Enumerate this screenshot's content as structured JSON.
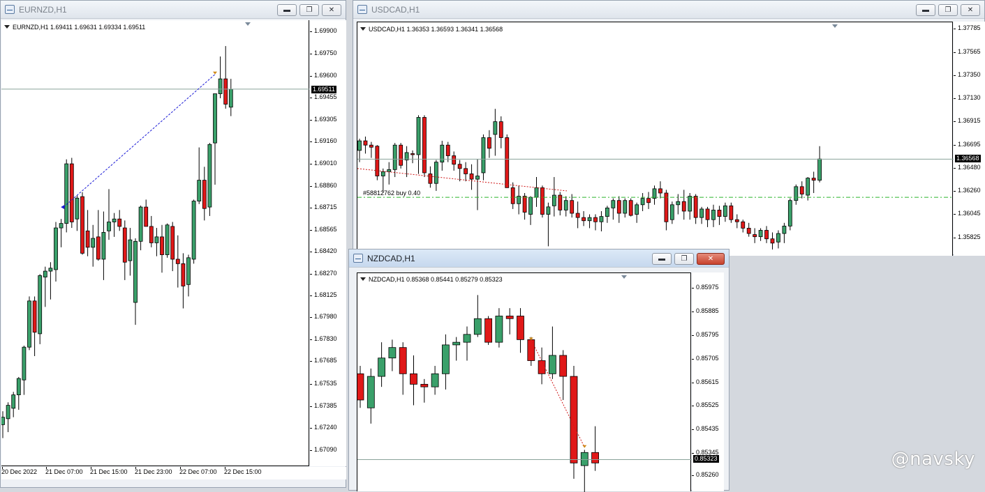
{
  "windows": {
    "eurnzd": {
      "title": "EURNZD,H1",
      "info": "EURNZD,H1  1.69411 1.69631 1.69334 1.69511",
      "current_price": "1.69511",
      "price_min": 1.67,
      "price_max": 1.6995,
      "price_labels": [
        "1.69900",
        "1.69750",
        "1.69600",
        "1.69455",
        "1.69305",
        "1.69160",
        "1.69010",
        "1.68860",
        "1.68715",
        "1.68565",
        "1.68420",
        "1.68270",
        "1.68125",
        "1.67980",
        "1.67830",
        "1.67685",
        "1.67535",
        "1.67385",
        "1.67240",
        "1.67090"
      ],
      "time_labels": [
        "20 Dec 2022",
        "21 Dec 07:00",
        "21 Dec 15:00",
        "21 Dec 23:00",
        "22 Dec 07:00",
        "22 Dec 15:00"
      ],
      "candles": [
        [
          1.6726,
          1.6735,
          1.6717,
          1.6731
        ],
        [
          1.673,
          1.6741,
          1.6721,
          1.6739
        ],
        [
          1.6737,
          1.6748,
          1.6731,
          1.6746
        ],
        [
          1.6746,
          1.6758,
          1.6736,
          1.6757
        ],
        [
          1.6756,
          1.6779,
          1.6746,
          1.6778
        ],
        [
          1.6778,
          1.6812,
          1.6776,
          1.6809
        ],
        [
          1.6809,
          1.6812,
          1.6772,
          1.6788
        ],
        [
          1.6787,
          1.6827,
          1.678,
          1.6826
        ],
        [
          1.6825,
          1.6832,
          1.6805,
          1.6829
        ],
        [
          1.6829,
          1.6835,
          1.681,
          1.6831
        ],
        [
          1.683,
          1.6862,
          1.6822,
          1.6858
        ],
        [
          1.6858,
          1.6864,
          1.6845,
          1.6861
        ],
        [
          1.6861,
          1.6904,
          1.6855,
          1.6901
        ],
        [
          1.6901,
          1.6905,
          1.6858,
          1.6862
        ],
        [
          1.6864,
          1.688,
          1.6856,
          1.6878
        ],
        [
          1.6879,
          1.6882,
          1.684,
          1.6841
        ],
        [
          1.6856,
          1.687,
          1.6839,
          1.6845
        ],
        [
          1.6845,
          1.686,
          1.6832,
          1.6851
        ],
        [
          1.6852,
          1.687,
          1.6836,
          1.6837
        ],
        [
          1.6837,
          1.6869,
          1.6823,
          1.6855
        ],
        [
          1.6856,
          1.6884,
          1.685,
          1.6862
        ],
        [
          1.6862,
          1.6868,
          1.6852,
          1.6864
        ],
        [
          1.6864,
          1.687,
          1.6856,
          1.6859
        ],
        [
          1.6858,
          1.6863,
          1.6823,
          1.6835
        ],
        [
          1.6836,
          1.6858,
          1.6826,
          1.685
        ],
        [
          1.6808,
          1.6851,
          1.6793,
          1.6849
        ],
        [
          1.6849,
          1.6873,
          1.6843,
          1.6872
        ],
        [
          1.6872,
          1.6877,
          1.6859,
          1.6859
        ],
        [
          1.6859,
          1.6866,
          1.6845,
          1.6848
        ],
        [
          1.6848,
          1.6858,
          1.6839,
          1.6852
        ],
        [
          1.6852,
          1.686,
          1.6828,
          1.684
        ],
        [
          1.684,
          1.6861,
          1.6838,
          1.686
        ],
        [
          1.6859,
          1.6862,
          1.6829,
          1.6837
        ],
        [
          1.6837,
          1.6853,
          1.6818,
          1.6834
        ],
        [
          1.6834,
          1.6841,
          1.6804,
          1.6819
        ],
        [
          1.682,
          1.684,
          1.6812,
          1.6838
        ],
        [
          1.6837,
          1.6877,
          1.6834,
          1.6876
        ],
        [
          1.6876,
          1.6912,
          1.6874,
          1.689
        ],
        [
          1.689,
          1.6899,
          1.6863,
          1.6871
        ],
        [
          1.6872,
          1.6915,
          1.6866,
          1.6914
        ],
        [
          1.6915,
          1.6925,
          1.6887,
          1.6948
        ],
        [
          1.6948,
          1.6973,
          1.6945,
          1.6958
        ],
        [
          1.6958,
          1.698,
          1.6938,
          1.6941
        ],
        [
          1.6939,
          1.6958,
          1.6933,
          1.6951
        ]
      ],
      "trade_line_color": "#1a1ad6",
      "bull_color": "#3aa06a",
      "bear_color": "#e01818"
    },
    "usdcad": {
      "title": "USDCAD,H1",
      "info": "USDCAD,H1  1.36353 1.36593 1.36341 1.36568",
      "current_price": "1.36568",
      "order_label": "#58812762 buy 0.40",
      "order_price": 1.3621,
      "price_min": 1.3572,
      "price_max": 1.3782,
      "price_labels": [
        "1.37785",
        "1.37565",
        "1.37350",
        "1.37130",
        "1.36915",
        "1.36695",
        "1.36480",
        "1.36260",
        "1.36045",
        "1.35825"
      ],
      "candles": [
        [
          1.3665,
          1.3676,
          1.3654,
          1.3674
        ],
        [
          1.3674,
          1.3678,
          1.3662,
          1.367
        ],
        [
          1.367,
          1.3673,
          1.3658,
          1.3668
        ],
        [
          1.3669,
          1.367,
          1.3637,
          1.3641
        ],
        [
          1.3641,
          1.3648,
          1.3625,
          1.3645
        ],
        [
          1.3645,
          1.3654,
          1.3633,
          1.3647
        ],
        [
          1.3647,
          1.3672,
          1.364,
          1.367
        ],
        [
          1.367,
          1.3672,
          1.3648,
          1.3651
        ],
        [
          1.3656,
          1.3669,
          1.364,
          1.3663
        ],
        [
          1.3662,
          1.3665,
          1.3653,
          1.3661
        ],
        [
          1.3661,
          1.3698,
          1.3643,
          1.3696
        ],
        [
          1.3696,
          1.3698,
          1.364,
          1.3644
        ],
        [
          1.3643,
          1.365,
          1.363,
          1.3634
        ],
        [
          1.3634,
          1.3656,
          1.3627,
          1.3654
        ],
        [
          1.3654,
          1.3674,
          1.3646,
          1.367
        ],
        [
          1.367,
          1.3673,
          1.3654,
          1.366
        ],
        [
          1.366,
          1.3664,
          1.3646,
          1.3652
        ],
        [
          1.3652,
          1.3656,
          1.3636,
          1.3648
        ],
        [
          1.3648,
          1.3654,
          1.3636,
          1.3643
        ],
        [
          1.3643,
          1.3652,
          1.3628,
          1.3638
        ],
        [
          1.3638,
          1.3657,
          1.3609,
          1.3641
        ],
        [
          1.3644,
          1.368,
          1.3637,
          1.3677
        ],
        [
          1.3677,
          1.3684,
          1.3658,
          1.3667
        ],
        [
          1.368,
          1.3704,
          1.366,
          1.3692
        ],
        [
          1.3692,
          1.3697,
          1.3667,
          1.3677
        ],
        [
          1.3677,
          1.368,
          1.363,
          1.363
        ],
        [
          1.363,
          1.3635,
          1.361,
          1.3615
        ],
        [
          1.3615,
          1.3632,
          1.3605,
          1.3622
        ],
        [
          1.3622,
          1.3625,
          1.36,
          1.3607
        ],
        [
          1.3605,
          1.3622,
          1.3595,
          1.3621
        ],
        [
          1.3621,
          1.364,
          1.3612,
          1.363
        ],
        [
          1.363,
          1.3632,
          1.3602,
          1.3605
        ],
        [
          1.3605,
          1.3616,
          1.3575,
          1.3612
        ],
        [
          1.3613,
          1.364,
          1.3603,
          1.3623
        ],
        [
          1.3623,
          1.3626,
          1.3604,
          1.3609
        ],
        [
          1.3609,
          1.3622,
          1.3603,
          1.3618
        ],
        [
          1.3618,
          1.3624,
          1.3602,
          1.3606
        ],
        [
          1.3606,
          1.3617,
          1.3592,
          1.3602
        ],
        [
          1.3602,
          1.3608,
          1.3594,
          1.3599
        ],
        [
          1.3599,
          1.3605,
          1.3592,
          1.3602
        ],
        [
          1.3602,
          1.3605,
          1.359,
          1.3598
        ],
        [
          1.3598,
          1.3608,
          1.3589,
          1.3603
        ],
        [
          1.3603,
          1.3613,
          1.3597,
          1.3611
        ],
        [
          1.3611,
          1.362,
          1.36,
          1.3618
        ],
        [
          1.3618,
          1.3622,
          1.3597,
          1.3606
        ],
        [
          1.3606,
          1.362,
          1.3602,
          1.3618
        ],
        [
          1.3618,
          1.362,
          1.3603,
          1.3604
        ],
        [
          1.3605,
          1.3616,
          1.3597,
          1.3614
        ],
        [
          1.3614,
          1.3625,
          1.3608,
          1.362
        ],
        [
          1.362,
          1.3626,
          1.361,
          1.3616
        ],
        [
          1.362,
          1.3632,
          1.3614,
          1.3629
        ],
        [
          1.3629,
          1.3636,
          1.362,
          1.3625
        ],
        [
          1.3625,
          1.3628,
          1.359,
          1.3598
        ],
        [
          1.36,
          1.3617,
          1.3596,
          1.3614
        ],
        [
          1.3614,
          1.3624,
          1.3605,
          1.3617
        ],
        [
          1.3617,
          1.3628,
          1.36,
          1.3608
        ],
        [
          1.3608,
          1.3625,
          1.36,
          1.3622
        ],
        [
          1.3622,
          1.3624,
          1.3596,
          1.3602
        ],
        [
          1.3602,
          1.3612,
          1.3596,
          1.361
        ],
        [
          1.361,
          1.3612,
          1.3593,
          1.36
        ],
        [
          1.36,
          1.3614,
          1.3593,
          1.3609
        ],
        [
          1.3609,
          1.3613,
          1.3595,
          1.3603
        ],
        [
          1.3603,
          1.3616,
          1.3598,
          1.3613
        ],
        [
          1.3613,
          1.3616,
          1.3597,
          1.36
        ],
        [
          1.36,
          1.3605,
          1.3592,
          1.3598
        ],
        [
          1.3598,
          1.36,
          1.3588,
          1.3592
        ],
        [
          1.3592,
          1.3597,
          1.3584,
          1.3587
        ],
        [
          1.3586,
          1.3592,
          1.3578,
          1.3584
        ],
        [
          1.3584,
          1.3592,
          1.358,
          1.359
        ],
        [
          1.359,
          1.3594,
          1.3578,
          1.3582
        ],
        [
          1.3582,
          1.3588,
          1.3572,
          1.3578
        ],
        [
          1.3579,
          1.359,
          1.3573,
          1.3587
        ],
        [
          1.3587,
          1.3597,
          1.3578,
          1.3594
        ],
        [
          1.3594,
          1.362,
          1.359,
          1.3618
        ],
        [
          1.3618,
          1.3633,
          1.3614,
          1.3631
        ],
        [
          1.3631,
          1.3636,
          1.362,
          1.3624
        ],
        [
          1.3623,
          1.364,
          1.3618,
          1.3639
        ],
        [
          1.3639,
          1.3645,
          1.3625,
          1.3637
        ],
        [
          1.3637,
          1.3669,
          1.3635,
          1.3657
        ]
      ]
    },
    "nzdcad": {
      "title": "NZDCAD,H1",
      "info": "NZDCAD,H1  0.85368 0.85441 0.85279 0.85323",
      "current_price": "0.85323",
      "price_min": 0.8521,
      "price_max": 0.8602,
      "price_labels": [
        "0.85975",
        "0.85885",
        "0.85795",
        "0.85705",
        "0.85615",
        "0.85525",
        "0.85435",
        "0.85345",
        "0.85260"
      ],
      "candles": [
        [
          0.8565,
          0.8568,
          0.8552,
          0.8555
        ],
        [
          0.8552,
          0.8567,
          0.8546,
          0.8564
        ],
        [
          0.8564,
          0.8577,
          0.856,
          0.8571
        ],
        [
          0.8571,
          0.8578,
          0.8566,
          0.8575
        ],
        [
          0.8575,
          0.8577,
          0.8557,
          0.8565
        ],
        [
          0.8565,
          0.8572,
          0.8553,
          0.8561
        ],
        [
          0.8561,
          0.8563,
          0.8554,
          0.856
        ],
        [
          0.856,
          0.8568,
          0.8557,
          0.8565
        ],
        [
          0.8565,
          0.858,
          0.8559,
          0.8576
        ],
        [
          0.8576,
          0.8579,
          0.857,
          0.8577
        ],
        [
          0.8577,
          0.8583,
          0.857,
          0.858
        ],
        [
          0.858,
          0.8595,
          0.8579,
          0.8586
        ],
        [
          0.8586,
          0.8587,
          0.8576,
          0.8577
        ],
        [
          0.8577,
          0.859,
          0.8575,
          0.8587
        ],
        [
          0.8587,
          0.859,
          0.858,
          0.8586
        ],
        [
          0.8587,
          0.859,
          0.8573,
          0.8578
        ],
        [
          0.8578,
          0.8579,
          0.8568,
          0.857
        ],
        [
          0.857,
          0.8575,
          0.8561,
          0.8565
        ],
        [
          0.8565,
          0.8583,
          0.8563,
          0.8572
        ],
        [
          0.8572,
          0.8574,
          0.8555,
          0.8564
        ],
        [
          0.8564,
          0.8568,
          0.8525,
          0.8531
        ],
        [
          0.853,
          0.8536,
          0.8518,
          0.8535
        ],
        [
          0.8535,
          0.8545,
          0.8528,
          0.8531
        ]
      ]
    }
  },
  "watermark": "@navsky"
}
